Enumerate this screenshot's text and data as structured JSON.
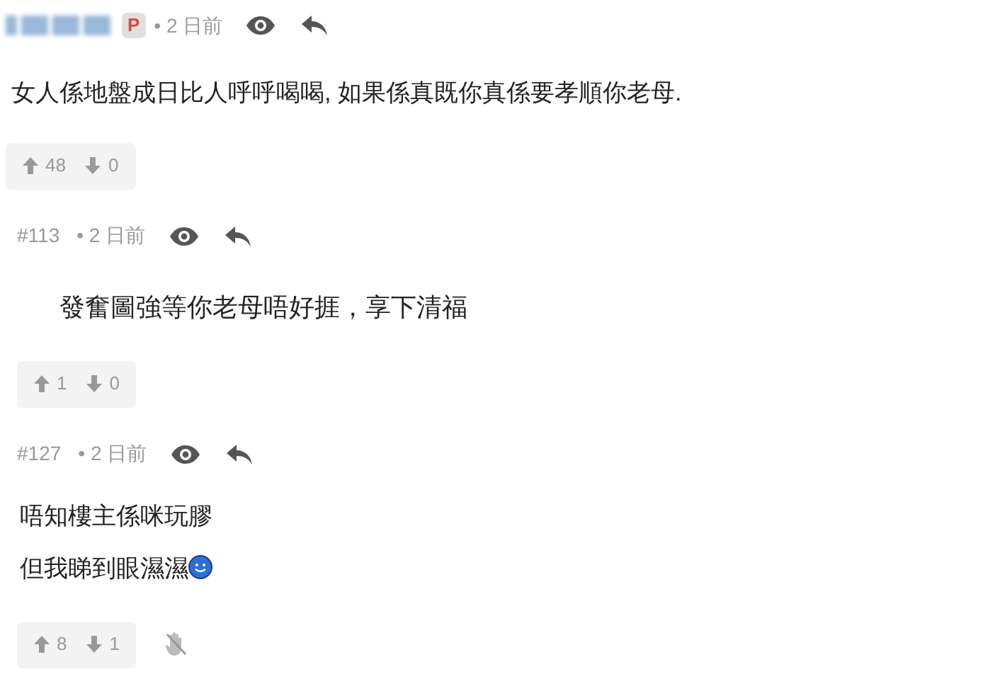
{
  "comments": [
    {
      "badge": "P",
      "time": "• 2 日前",
      "body": [
        "女人係地盤成日比人呼呼喝喝, 如果係真既你真係要孝順你老母."
      ],
      "trailing_emoji": false,
      "upvotes": "48",
      "downvotes": "0",
      "hand_icon": false
    },
    {
      "number": "#113",
      "time": "• 2 日前",
      "body": [
        "發奮圖強等你老母唔好捱，享下清福"
      ],
      "trailing_emoji": false,
      "upvotes": "1",
      "downvotes": "0",
      "hand_icon": false
    },
    {
      "number": "#127",
      "time": "• 2 日前",
      "body": [
        "唔知樓主係咪玩膠",
        "但我睇到眼濕濕"
      ],
      "trailing_emoji": true,
      "upvotes": "8",
      "downvotes": "1",
      "hand_icon": true
    }
  ]
}
